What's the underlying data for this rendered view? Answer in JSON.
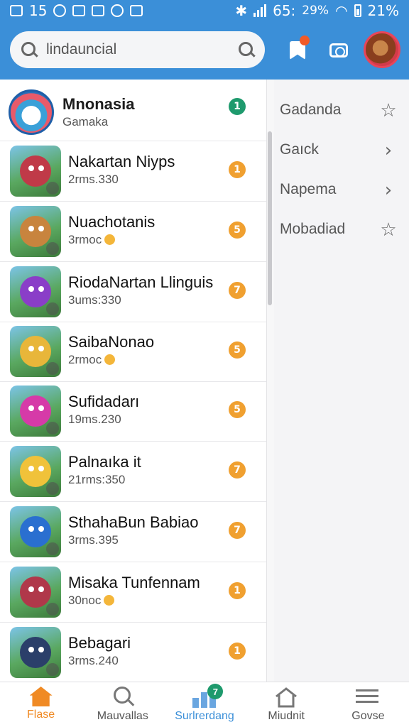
{
  "status_bar": {
    "left_text": "15",
    "time": "65:",
    "battery_pct": "29%",
    "battery_right": "21%"
  },
  "search": {
    "value": "lindauncial"
  },
  "list": [
    {
      "title": "Mnonasia",
      "subtitle": "Gamaka",
      "count": "1",
      "coin": false,
      "thumb_color": "#3aa0d8",
      "count_color": "#1e9a6d"
    },
    {
      "title": "Nakartan Niyps",
      "subtitle": "2rms.330",
      "count": "1",
      "coin": false,
      "thumb_color": "#c03a48",
      "count_color": "#f0a030"
    },
    {
      "title": "Nuachotanis",
      "subtitle": "3rmoc",
      "count": "5",
      "coin": true,
      "thumb_color": "#c8843e",
      "count_color": "#f0a030"
    },
    {
      "title": "RiodaNartan Llinguis",
      "subtitle": "3ums:330",
      "count": "7",
      "coin": false,
      "thumb_color": "#8a3ec8",
      "count_color": "#f0a030"
    },
    {
      "title": "SaibaNonao",
      "subtitle": "2rmoc",
      "count": "5",
      "coin": true,
      "thumb_color": "#e8b63a",
      "count_color": "#f0a030"
    },
    {
      "title": "Sufidadarı",
      "subtitle": "19ms.230",
      "count": "5",
      "coin": false,
      "thumb_color": "#d63aa8",
      "count_color": "#f0a030"
    },
    {
      "title": "Palnaıka it",
      "subtitle": "21rms:350",
      "count": "7",
      "coin": false,
      "thumb_color": "#f0c23a",
      "count_color": "#f0a030"
    },
    {
      "title": "SthahaBun Babiao",
      "subtitle": "3rms.395",
      "count": "7",
      "coin": false,
      "thumb_color": "#2a6fd0",
      "count_color": "#f0a030"
    },
    {
      "title": "Misaka Tunfennam",
      "subtitle": "30noc",
      "count": "1",
      "coin": true,
      "thumb_color": "#b0384a",
      "count_color": "#f0a030"
    },
    {
      "title": "Bebagari",
      "subtitle": "3rms.240",
      "count": "1",
      "coin": false,
      "thumb_color": "#2b3f6a",
      "count_color": "#f0a030"
    }
  ],
  "panel": [
    {
      "label": "Gadanda",
      "icon": "star-icon"
    },
    {
      "label": "Gaıck",
      "icon": "chevron-right-icon"
    },
    {
      "label": "Napema",
      "icon": "chevron-right-icon"
    },
    {
      "label": "Mobadiad",
      "icon": "star-icon"
    }
  ],
  "bottom_nav": [
    {
      "label": "Flase",
      "icon": "home-icon"
    },
    {
      "label": "Mauvallas",
      "icon": "search-icon"
    },
    {
      "label": "Surlrerdang",
      "icon": "chart-icon",
      "badge": "7"
    },
    {
      "label": "Miudnit",
      "icon": "house-outline-icon"
    },
    {
      "label": "Govse",
      "icon": "list-icon"
    }
  ],
  "colors": {
    "accent": "#3b8fd8",
    "active_tab": "#f08a24",
    "badge_green": "#1e9a6d",
    "badge_orange": "#f0a030"
  }
}
